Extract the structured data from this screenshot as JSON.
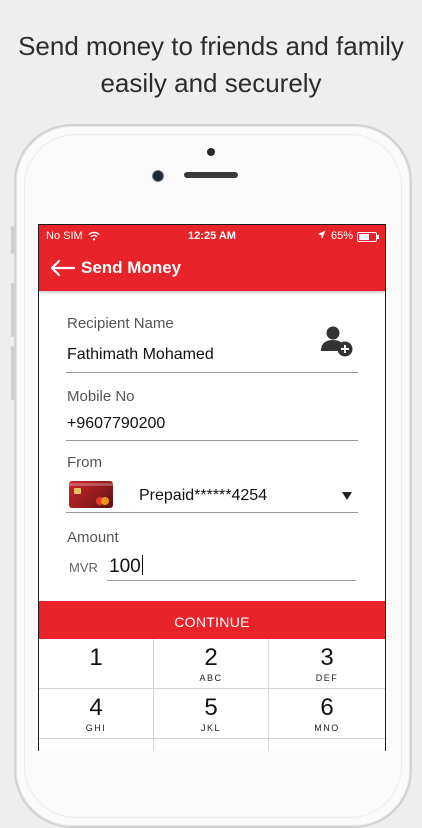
{
  "headline": {
    "line1": "Send money to friends and family",
    "line2": "easily and securely"
  },
  "status_bar": {
    "carrier": "No SIM",
    "time": "12:25 AM",
    "battery_percent": "65%",
    "battery_level": 0.65
  },
  "app_bar": {
    "title": "Send Money"
  },
  "form": {
    "recipient": {
      "label": "Recipient Name",
      "value": "Fathimath Mohamed"
    },
    "mobile": {
      "label": "Mobile No",
      "value": "+9607790200"
    },
    "from": {
      "label": "From",
      "value": "Prepaid******4254"
    },
    "amount": {
      "label": "Amount",
      "currency": "MVR",
      "value": "100"
    }
  },
  "continue_label": "CONTINUE",
  "keypad": [
    {
      "num": "1",
      "letters": ""
    },
    {
      "num": "2",
      "letters": "ABC"
    },
    {
      "num": "3",
      "letters": "DEF"
    },
    {
      "num": "4",
      "letters": "GHI"
    },
    {
      "num": "5",
      "letters": "JKL"
    },
    {
      "num": "6",
      "letters": "MNO"
    }
  ],
  "colors": {
    "brand_red": "#e8232a",
    "background": "#eeeeee"
  }
}
